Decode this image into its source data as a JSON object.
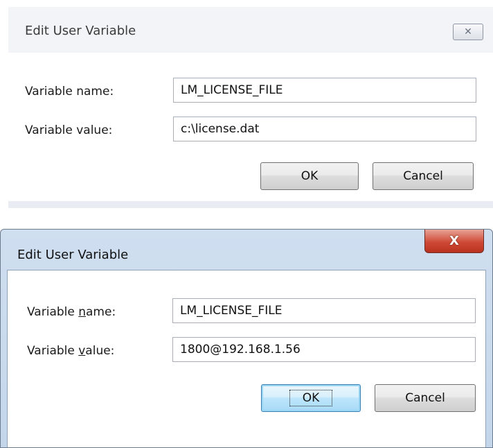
{
  "dialog_top": {
    "title": "Edit User Variable",
    "close_glyph": "✕",
    "variable_name_label": "Variable name:",
    "variable_value_label": "Variable value:",
    "variable_name_value": "LM_LICENSE_FILE",
    "variable_value_value": "c:\\license.dat",
    "ok_label": "OK",
    "cancel_label": "Cancel"
  },
  "dialog_bottom": {
    "title": "Edit User Variable",
    "close_glyph": "X",
    "variable_name_label_pre": "Variable ",
    "variable_name_label_accel": "n",
    "variable_name_label_post": "ame:",
    "variable_value_label_pre": "Variable ",
    "variable_value_label_accel": "v",
    "variable_value_label_post": "alue:",
    "variable_name_value": "LM_LICENSE_FILE",
    "variable_value_value": "1800@192.168.1.56",
    "ok_label": "OK",
    "cancel_label": "Cancel"
  },
  "colors": {
    "inactive_frame": "#e9edf3",
    "active_frame": "#c4d6ea",
    "close_button_red": "#cf4a36",
    "default_button_blue": "#3c7fb1"
  }
}
